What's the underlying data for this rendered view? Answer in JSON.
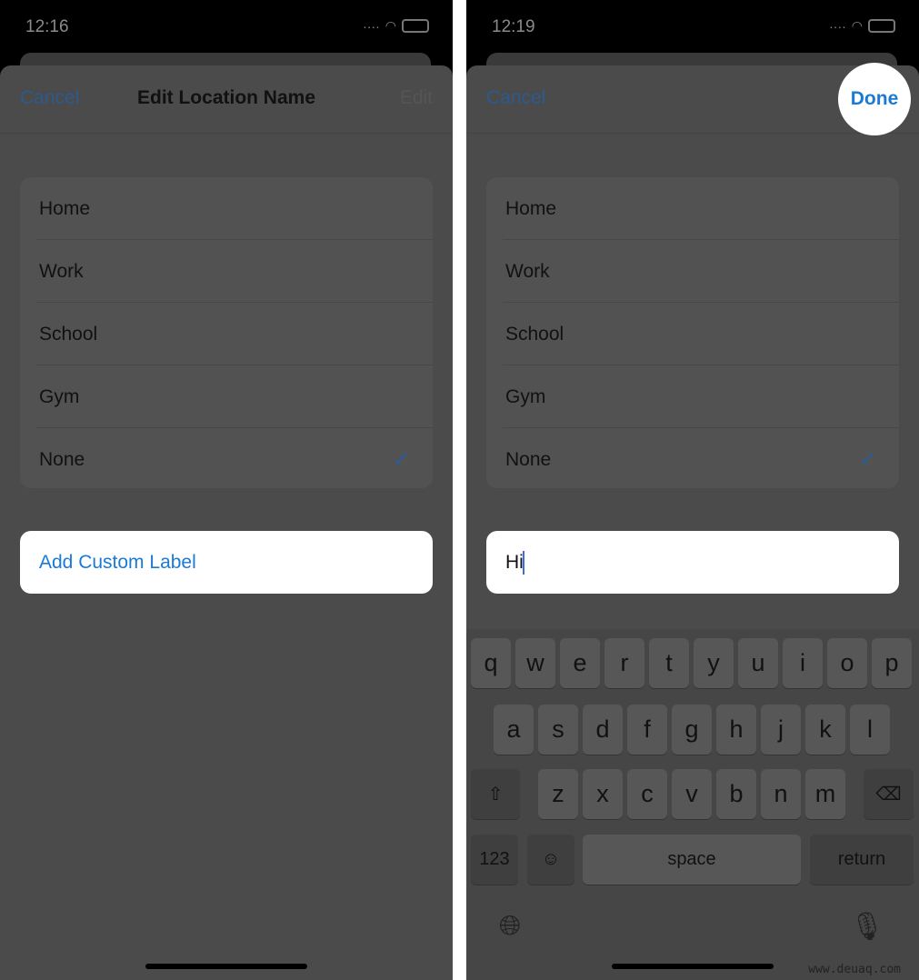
{
  "left": {
    "status": {
      "time": "12:16"
    },
    "nav": {
      "cancel": "Cancel",
      "title": "Edit Location Name",
      "edit": "Edit"
    },
    "items": [
      "Home",
      "Work",
      "School",
      "Gym",
      "None"
    ],
    "selected": "None",
    "custom_label": "Add Custom Label"
  },
  "right": {
    "status": {
      "time": "12:19"
    },
    "nav": {
      "cancel": "Cancel",
      "done": "Done"
    },
    "items": [
      "Home",
      "Work",
      "School",
      "Gym",
      "None"
    ],
    "selected": "None",
    "input_value": "Hi",
    "keyboard": {
      "row1": [
        "q",
        "w",
        "e",
        "r",
        "t",
        "y",
        "u",
        "i",
        "o",
        "p"
      ],
      "row2": [
        "a",
        "s",
        "d",
        "f",
        "g",
        "h",
        "j",
        "k",
        "l"
      ],
      "row3": [
        "z",
        "x",
        "c",
        "v",
        "b",
        "n",
        "m"
      ],
      "numbers": "123",
      "space": "space",
      "return": "return"
    },
    "watermark": "www.deuaq.com"
  },
  "colors": {
    "accent": "#1a7ad6",
    "dim_bg": "#4b4b4b"
  }
}
